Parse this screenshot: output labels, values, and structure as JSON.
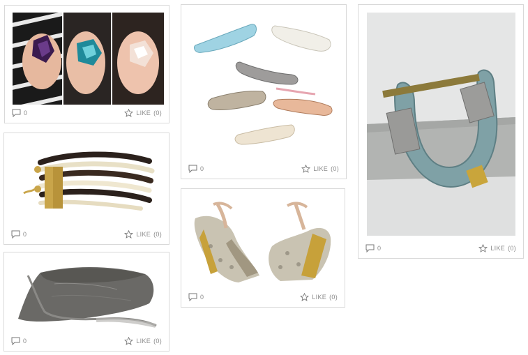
{
  "cards": [
    {
      "id": "rings",
      "comments": "0",
      "like_label": "LIKE",
      "like_count": "(0)"
    },
    {
      "id": "flats",
      "comments": "0",
      "like_label": "LIKE",
      "like_count": "(0)"
    },
    {
      "id": "cuff",
      "comments": "0",
      "like_label": "LIKE",
      "like_count": "(0)"
    },
    {
      "id": "bracelet",
      "comments": "0",
      "like_label": "LIKE",
      "like_count": "(0)"
    },
    {
      "id": "wedges",
      "comments": "0",
      "like_label": "LIKE",
      "like_count": "(0)"
    },
    {
      "id": "clutch",
      "comments": "0",
      "like_label": "LIKE",
      "like_count": "(0)"
    }
  ],
  "icons": {
    "comment": "speech-bubble-icon",
    "like": "star-icon"
  },
  "colors": {
    "border": "#d9d9d9",
    "meta_text": "#8a8a8a"
  }
}
